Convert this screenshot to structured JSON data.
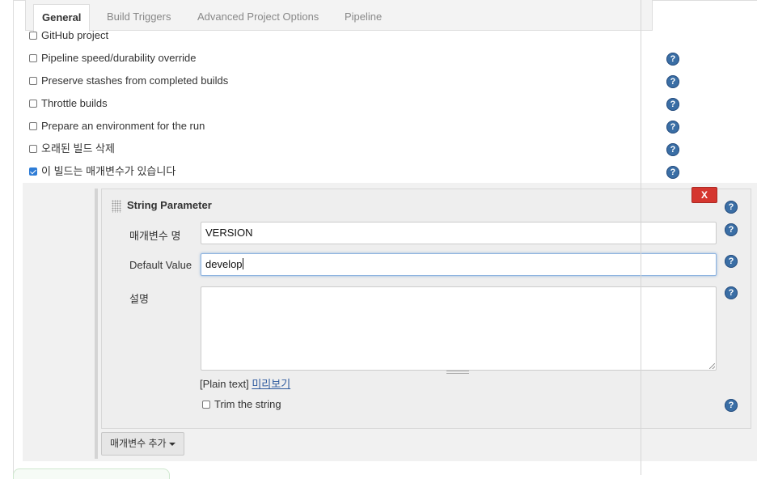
{
  "tabs": [
    {
      "label": "General",
      "active": true
    },
    {
      "label": "Build Triggers"
    },
    {
      "label": "Advanced Project Options"
    },
    {
      "label": "Pipeline"
    }
  ],
  "options": [
    {
      "label": "GitHub project",
      "checked": false
    },
    {
      "label": "Pipeline speed/durability override",
      "checked": false
    },
    {
      "label": "Preserve stashes from completed builds",
      "checked": false
    },
    {
      "label": "Throttle builds",
      "checked": false
    },
    {
      "label": "Prepare an environment for the run",
      "checked": false
    },
    {
      "label": "오래된 빌드 삭제",
      "checked": false
    },
    {
      "label": "이 빌드는 매개변수가 있습니다",
      "checked": true
    }
  ],
  "parameter": {
    "title": "String Parameter",
    "delete_label": "X",
    "name_label": "매개변수 명",
    "name_value": "VERSION",
    "default_label": "Default Value",
    "default_value": "develop",
    "description_label": "설명",
    "description_value": "",
    "plain_text": "[Plain text]",
    "preview_link": "미리보기",
    "trim_label": "Trim the string",
    "trim_checked": false
  },
  "add_parameter_label": "매개변수 추가",
  "icons": {
    "help": "help-icon",
    "dropdown": "chevron-down-icon"
  },
  "colors": {
    "link": "#2e5a9e",
    "delete": "#d5362f",
    "help": "#3a6ea5",
    "checkbox": "#2e7cd6"
  }
}
